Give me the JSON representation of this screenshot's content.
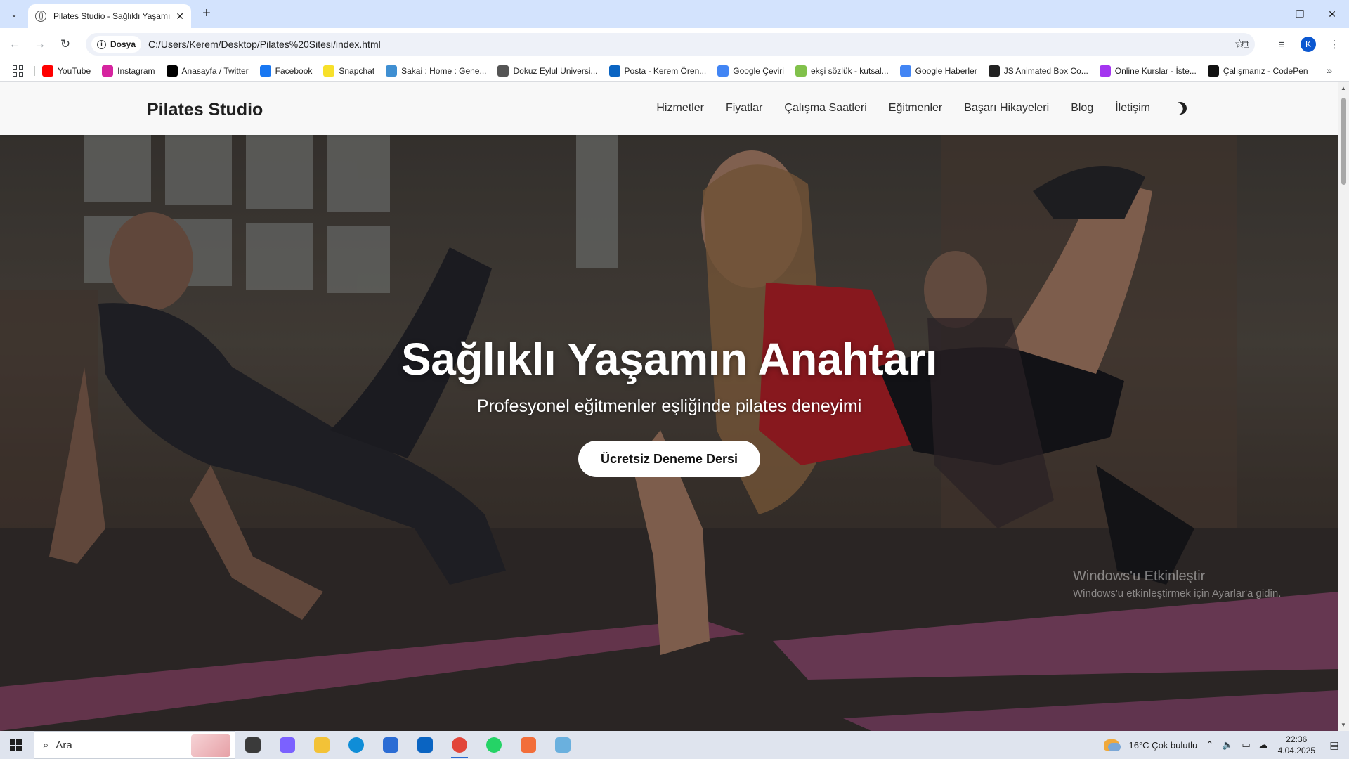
{
  "browser": {
    "tab_title": "Pilates Studio - Sağlıklı Yaşamın Anahtarı",
    "site_chip_label": "Dosya",
    "url": "C:/Users/Kerem/Desktop/Pilates%20Sitesi/index.html",
    "profile_initial": "K",
    "bookmarks": [
      {
        "label": "YouTube",
        "icon": "youtube-icon",
        "color": "#ff0000"
      },
      {
        "label": "Instagram",
        "icon": "instagram-icon",
        "color": "#d6249f"
      },
      {
        "label": "Anasayfa / Twitter",
        "icon": "x-icon",
        "color": "#000000"
      },
      {
        "label": "Facebook",
        "icon": "facebook-icon",
        "color": "#1877f2"
      },
      {
        "label": "Snapchat",
        "icon": "snapchat-icon",
        "color": "#f7e02a"
      },
      {
        "label": "Sakai : Home : Gene...",
        "icon": "sakai-icon",
        "color": "#3f8fd2"
      },
      {
        "label": "Dokuz Eylul Universi...",
        "icon": "deu-icon",
        "color": "#555555"
      },
      {
        "label": "Posta - Kerem Ören...",
        "icon": "outlook-icon",
        "color": "#0a64c2"
      },
      {
        "label": "Google Çeviri",
        "icon": "translate-icon",
        "color": "#4285f4"
      },
      {
        "label": "ekşi sözlük - kutsal...",
        "icon": "eksi-icon",
        "color": "#81c14b"
      },
      {
        "label": "Google Haberler",
        "icon": "news-icon",
        "color": "#4285f4"
      },
      {
        "label": "JS Animated Box Co...",
        "icon": "codepen-like-icon",
        "color": "#222222"
      },
      {
        "label": "Online Kurslar - İste...",
        "icon": "udemy-icon",
        "color": "#a435f0"
      },
      {
        "label": "Çalışmanız - CodePen",
        "icon": "codepen-icon",
        "color": "#111111"
      }
    ]
  },
  "site": {
    "logo": "Pilates Studio",
    "menu": [
      "Hizmetler",
      "Fiyatlar",
      "Çalışma Saatleri",
      "Eğitmenler",
      "Başarı Hikayeleri",
      "Blog",
      "İletişim"
    ],
    "hero": {
      "title": "Sağlıklı Yaşamın Anahtarı",
      "subtitle": "Profesyonel eğitmenler eşliğinde pilates deneyimi",
      "cta": "Ücretsiz Deneme Dersi"
    }
  },
  "watermark": {
    "line1": "Windows'u Etkinleştir",
    "line2": "Windows'u etkinleştirmek için Ayarlar'a gidin."
  },
  "taskbar": {
    "search_placeholder": "Ara",
    "weather": "16°C  Çok bulutlu",
    "time": "22:36",
    "date": "4.04.2025",
    "apps": [
      {
        "name": "task-view",
        "color": "#3a3a3a"
      },
      {
        "name": "copilot",
        "color": "#7b61ff"
      },
      {
        "name": "file-explorer",
        "color": "#f3c237"
      },
      {
        "name": "edge",
        "color": "#0f8dd7"
      },
      {
        "name": "microsoft-store",
        "color": "#2b6cd4"
      },
      {
        "name": "outlook",
        "color": "#0a64c2"
      },
      {
        "name": "chrome",
        "color": "#e2463a"
      },
      {
        "name": "whatsapp",
        "color": "#25d366"
      },
      {
        "name": "xampp",
        "color": "#f26e3a"
      },
      {
        "name": "notepad",
        "color": "#6ab0de"
      }
    ]
  }
}
